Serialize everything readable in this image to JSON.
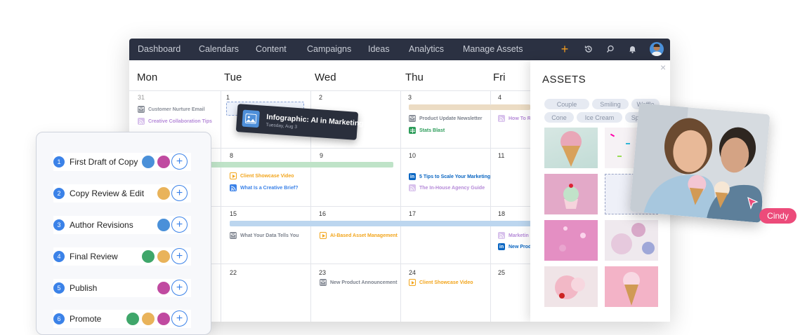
{
  "nav": {
    "items": [
      "Dashboard",
      "Calendars",
      "Content",
      "Campaigns",
      "Ideas",
      "Analytics",
      "Manage Assets"
    ],
    "icons": [
      "plus-icon",
      "history-icon",
      "search-icon",
      "bell-icon",
      "avatar"
    ],
    "accent": "#f29c1f"
  },
  "calendar": {
    "days": [
      "Mon",
      "Tue",
      "Wed",
      "Thu",
      "Fri"
    ],
    "dates": [
      "31",
      "1",
      "2",
      "3",
      "4",
      "8",
      "9",
      "10",
      "11",
      "15",
      "16",
      "17",
      "18",
      "22",
      "23",
      "24",
      "25"
    ],
    "events": [
      {
        "label": "Customer Nurture Email",
        "type": "email"
      },
      {
        "label": "Creative Collaboration Tips",
        "type": "rss"
      },
      {
        "label": "Product Update Newsletter",
        "type": "email"
      },
      {
        "label": "Stats Blast",
        "type": "sheet"
      },
      {
        "label": "How To R",
        "type": "rss"
      },
      {
        "label": "Client Showcase Video",
        "type": "video"
      },
      {
        "label": "What Is a Creative Brief?",
        "type": "rss"
      },
      {
        "label": "5 Tips to Scale Your Marketing",
        "type": "linkedin"
      },
      {
        "label": "The In-House Agency Guide",
        "type": "rss"
      },
      {
        "label": "What Your Data Tells You",
        "type": "email"
      },
      {
        "label": "AI-Based Asset Management",
        "type": "video"
      },
      {
        "label": "Marketin",
        "type": "rss"
      },
      {
        "label": "New Prod",
        "type": "linkedin"
      },
      {
        "label": "New Product Announcement",
        "type": "email"
      },
      {
        "label": "Client Showcase Video",
        "type": "video"
      }
    ]
  },
  "drag_card": {
    "title": "Infographic: AI in Marketing",
    "date": "Tuesday, Aug 3"
  },
  "assets": {
    "title": "ASSETS",
    "tags": [
      "Couple",
      "Smiling",
      "Waffle",
      "Cone",
      "Ice Cream",
      "Sprinkle"
    ],
    "close": "×"
  },
  "workflow": {
    "steps": [
      {
        "num": "1",
        "label": "First Draft of Copy"
      },
      {
        "num": "2",
        "label": "Copy Review & Edit"
      },
      {
        "num": "3",
        "label": "Author Revisions"
      },
      {
        "num": "4",
        "label": "Final Review"
      },
      {
        "num": "5",
        "label": "Publish"
      },
      {
        "num": "6",
        "label": "Promote"
      }
    ],
    "add": "+"
  },
  "cursor_label": "Cindy",
  "colors": {
    "email": "#8a8f99",
    "rss": "#b58ad8",
    "video": "#f2a51c",
    "linkedin": "#0a66c2",
    "sheet": "#2e9d5b",
    "green_bar": "#bfe3c8",
    "blue_bar": "#bcd6ef",
    "tan_bar": "#ecdcc4"
  }
}
